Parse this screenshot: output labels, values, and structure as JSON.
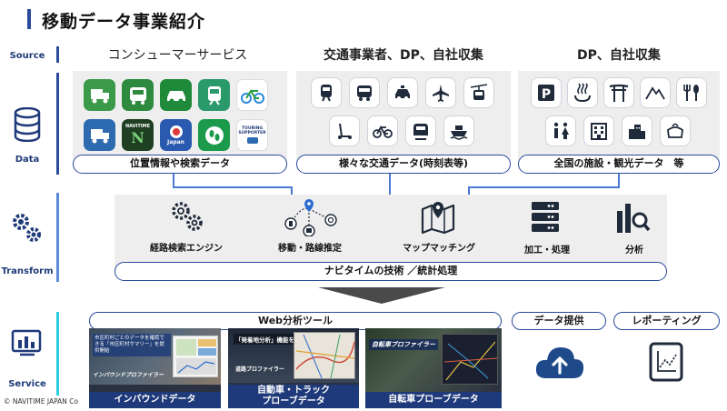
{
  "title": "移動データ事業紹介",
  "stages": {
    "source": "Source",
    "data": "Data",
    "transform": "Transform",
    "service": "Service"
  },
  "sources": {
    "consumer": "コンシューマーサービス",
    "transport": "交通事業者、DP、自社収集",
    "dp": "DP、自社収集"
  },
  "data_pills": {
    "consumer": "位置情報や検索データ",
    "transport": "様々な交通データ(時刻表等)",
    "facility": "全国の施設・観光データ　等"
  },
  "apps": [
    {
      "icon": "truck-app-icon",
      "color": "#3a9a4a",
      "text": ""
    },
    {
      "icon": "bus-app-icon",
      "color": "#2d8a3e",
      "text": ""
    },
    {
      "icon": "car-app-icon",
      "color": "#1e8a3a",
      "text": ""
    },
    {
      "icon": "train-app-icon",
      "color": "#2a9a6a",
      "text": ""
    },
    {
      "icon": "bicycle-app-icon",
      "color": "#ffffff",
      "text": ""
    },
    {
      "icon": "truck-blue-app-icon",
      "color": "#2d6ab0",
      "text": ""
    },
    {
      "icon": "navitime-n-app-icon",
      "color": "#1f3f22",
      "text": "NAVITIME"
    },
    {
      "icon": "japan-travel-app-icon",
      "color": "#2a5ab0",
      "text": "Japan"
    },
    {
      "icon": "footsteps-app-icon",
      "color": "#1a9a4a",
      "text": ""
    },
    {
      "icon": "touring-supporter-app-icon",
      "color": "#ffffff",
      "text": "TOURING SUPPORTER"
    }
  ],
  "transport_icons": [
    "train-icon",
    "bus-icon",
    "taxi-icon",
    "airplane-icon",
    "ropeway-icon",
    "kickscooter-icon",
    "bicycle-icon",
    "shinkansen-icon",
    "ship-icon"
  ],
  "facility_icons": [
    "parking-icon",
    "hot-spring-icon",
    "shrine-icon",
    "mountain-icon",
    "restaurant-icon",
    "restroom-icon",
    "building-icon",
    "city-icon",
    "souvenir-icon"
  ],
  "transform": {
    "steps": [
      {
        "label": "経路検索エンジン",
        "icon": "gears-icon"
      },
      {
        "label": "移動・路線推定",
        "icon": "route-network-icon"
      },
      {
        "label": "マップマッチング",
        "icon": "map-pin-icon"
      },
      {
        "label": "加工・処理",
        "icon": "server-icon"
      },
      {
        "label": "分析",
        "icon": "analysis-icon"
      }
    ],
    "pill": "ナビタイムの技術 ／統計処理"
  },
  "service": {
    "web_tool": "Web分析ツール",
    "data_provision": "データ提供",
    "reporting": "レポーティング",
    "shots": [
      {
        "caption": "インバウンドデータ",
        "overlay": "市区町村ごとのデータを確認できる「市区町村サマリー」を提供開始",
        "brand": "インバウンドプロファイラー"
      },
      {
        "caption": "自動車・トラック\nプローブデータ",
        "overlay": "「発着地分析」機能を追加",
        "brand": "道路プロファイラー"
      },
      {
        "caption": "自転車プローブデータ",
        "overlay": "",
        "brand": "自転車プロファイラー"
      }
    ]
  },
  "copyright": "© NAVITIME JAPAN Co"
}
